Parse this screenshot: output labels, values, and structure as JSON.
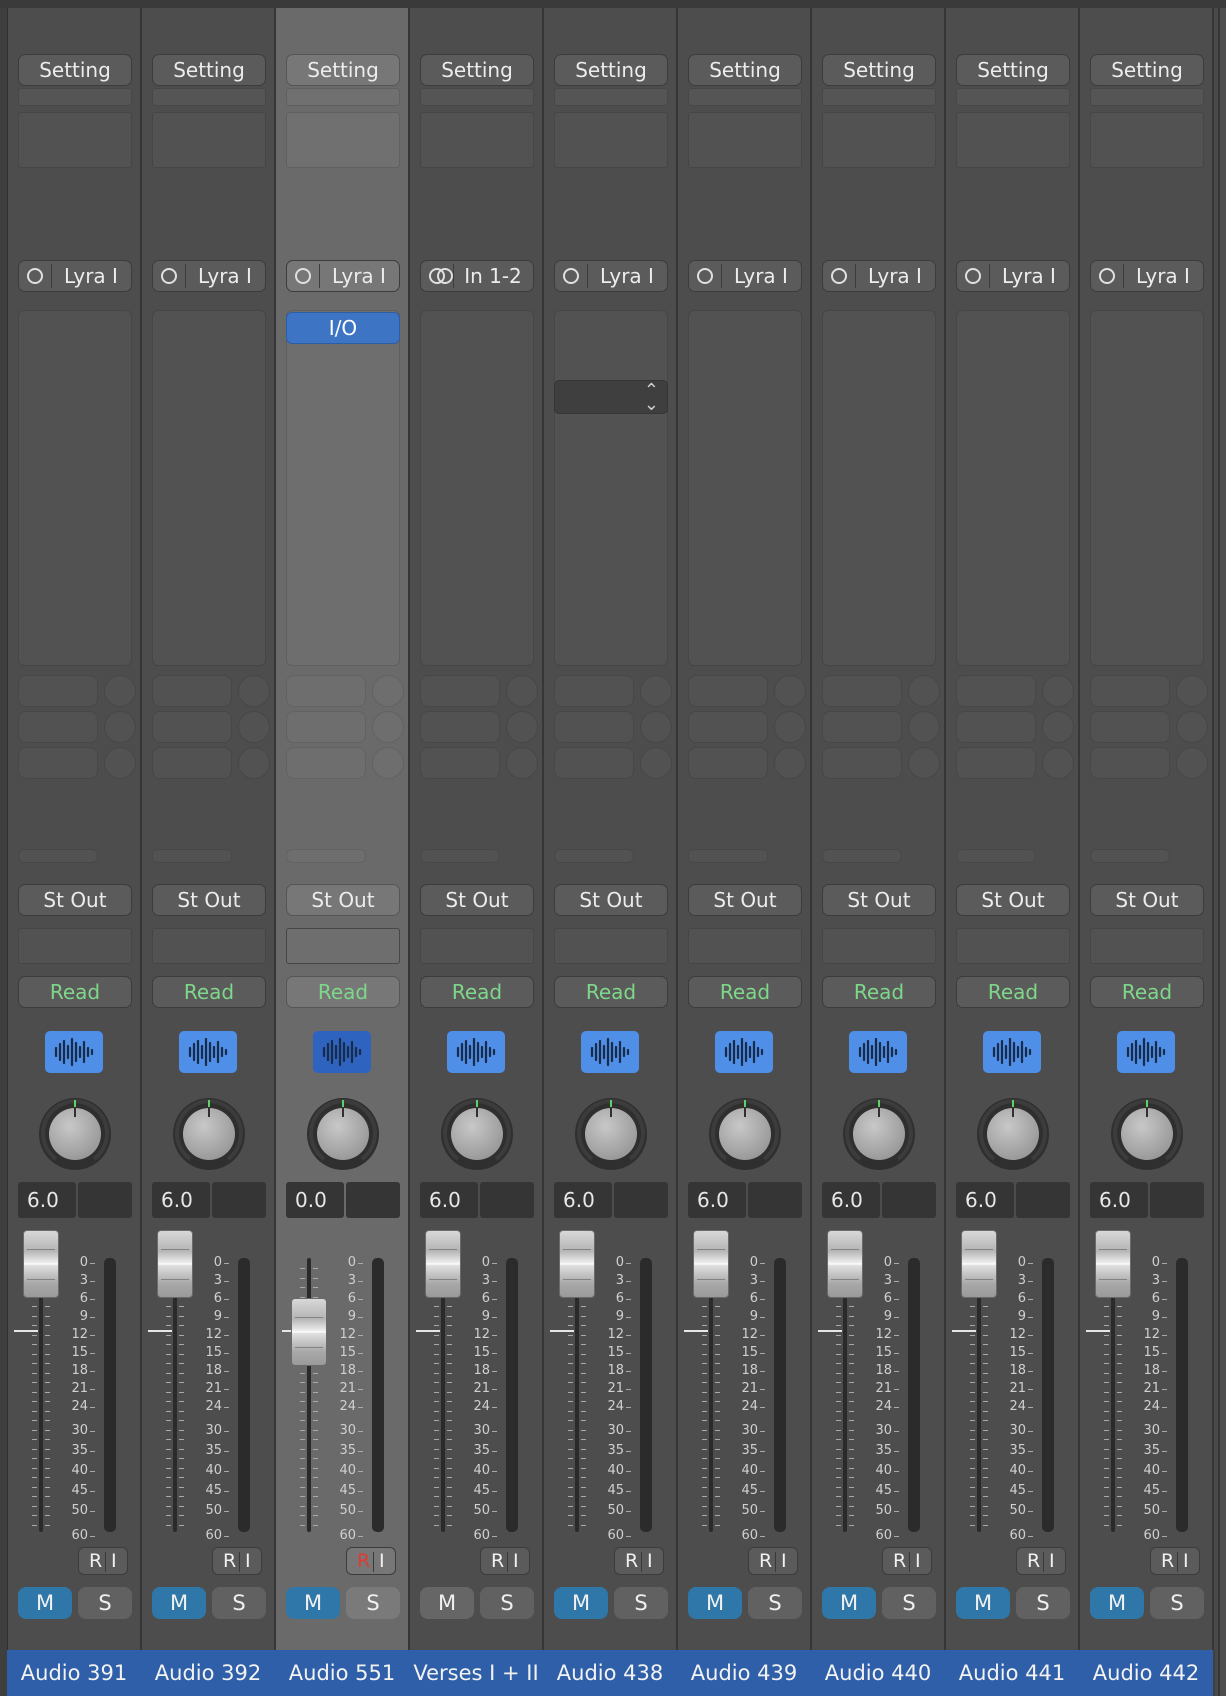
{
  "strip_defaults": {
    "setting_label": "Setting",
    "output_label": "St Out",
    "automation_label": "Read",
    "record_label": "R",
    "input_monitor_label": "I",
    "mute_label": "M",
    "solo_label": "S"
  },
  "strips": [
    {
      "name": "Audio 391",
      "input": "Lyra I",
      "input_icon": "mono-input-icon",
      "volume": "6.0",
      "selected": false,
      "muted": true,
      "record_armed": false,
      "has_io_plugin": false,
      "has_popup": false
    },
    {
      "name": "Audio 392",
      "input": "Lyra I",
      "input_icon": "mono-input-icon",
      "volume": "6.0",
      "selected": false,
      "muted": true,
      "record_armed": false,
      "has_io_plugin": false,
      "has_popup": false
    },
    {
      "name": "Audio 551",
      "input": "Lyra I",
      "input_icon": "mono-input-icon",
      "volume": "0.0",
      "selected": true,
      "muted": true,
      "record_armed": true,
      "has_io_plugin": true,
      "io_plugin_label": "I/O",
      "has_popup": false
    },
    {
      "name": "Verses I + II",
      "input": "In 1-2",
      "input_icon": "stereo-input-icon",
      "volume": "6.0",
      "selected": false,
      "muted": false,
      "record_armed": false,
      "has_io_plugin": false,
      "has_popup": false
    },
    {
      "name": "Audio 438",
      "input": "Lyra I",
      "input_icon": "mono-input-icon",
      "volume": "6.0",
      "selected": false,
      "muted": true,
      "record_armed": false,
      "has_io_plugin": false,
      "has_popup": true
    },
    {
      "name": "Audio 439",
      "input": "Lyra I",
      "input_icon": "mono-input-icon",
      "volume": "6.0",
      "selected": false,
      "muted": true,
      "record_armed": false,
      "has_io_plugin": false,
      "has_popup": false
    },
    {
      "name": "Audio 440",
      "input": "Lyra I",
      "input_icon": "mono-input-icon",
      "volume": "6.0",
      "selected": false,
      "muted": true,
      "record_armed": false,
      "has_io_plugin": false,
      "has_popup": false
    },
    {
      "name": "Audio 441",
      "input": "Lyra I",
      "input_icon": "mono-input-icon",
      "volume": "6.0",
      "selected": false,
      "muted": true,
      "record_armed": false,
      "has_io_plugin": false,
      "has_popup": false
    },
    {
      "name": "Audio 442",
      "input": "Lyra I",
      "input_icon": "mono-input-icon",
      "volume": "6.0",
      "selected": false,
      "muted": true,
      "record_armed": false,
      "has_io_plugin": false,
      "has_popup": false
    }
  ],
  "fader_scale": [
    "0",
    "3",
    "6",
    "9",
    "12",
    "15",
    "18",
    "21",
    "24",
    "30",
    "35",
    "40",
    "45",
    "50",
    "60"
  ],
  "colors": {
    "mute_active": "#2f77a8",
    "automation_read": "#7fd88a",
    "record_armed": "#e03b32",
    "name_bar": "#2f5fa8",
    "waveform_button": "#4f8fe8"
  }
}
